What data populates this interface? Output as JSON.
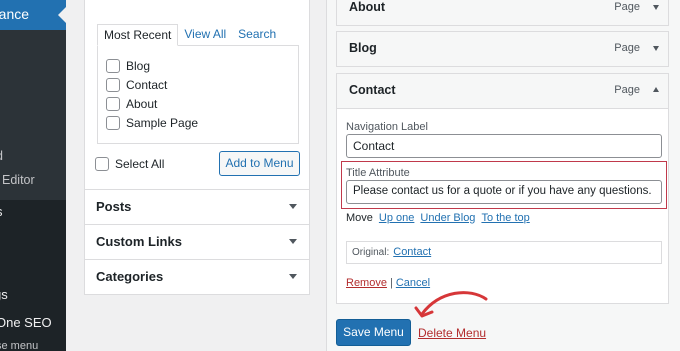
{
  "admin_menu": {
    "active_item": "rance",
    "items": [
      "d",
      "Editor",
      "s",
      "gs",
      "One SEO",
      "se menu"
    ]
  },
  "left_panel": {
    "tabs": [
      "Most Recent",
      "View All",
      "Search"
    ],
    "pages": [
      "Blog",
      "Contact",
      "About",
      "Sample Page"
    ],
    "select_all": "Select All",
    "add_to_menu": "Add to Menu",
    "sections": [
      "Posts",
      "Custom Links",
      "Categories"
    ]
  },
  "menu_structure": {
    "items": [
      {
        "title": "About",
        "type": "Page"
      },
      {
        "title": "Blog",
        "type": "Page"
      },
      {
        "title": "Contact",
        "type": "Page"
      }
    ],
    "settings": {
      "nav_label_label": "Navigation Label",
      "nav_label_value": "Contact",
      "title_attr_label": "Title Attribute",
      "title_attr_value": "Please contact us for a quote or if you have any questions.",
      "move_label": "Move",
      "move_links": [
        "Up one",
        "Under Blog",
        "To the top"
      ],
      "original_label": "Original:",
      "original_link": "Contact",
      "remove": "Remove",
      "separator": "|",
      "cancel": "Cancel"
    },
    "save_menu": "Save Menu",
    "delete_menu": "Delete Menu"
  },
  "colors": {
    "primary": "#2271b1",
    "delete": "#b32d2e",
    "highlight": "#c0394b",
    "sidebar": "#1d2327"
  }
}
